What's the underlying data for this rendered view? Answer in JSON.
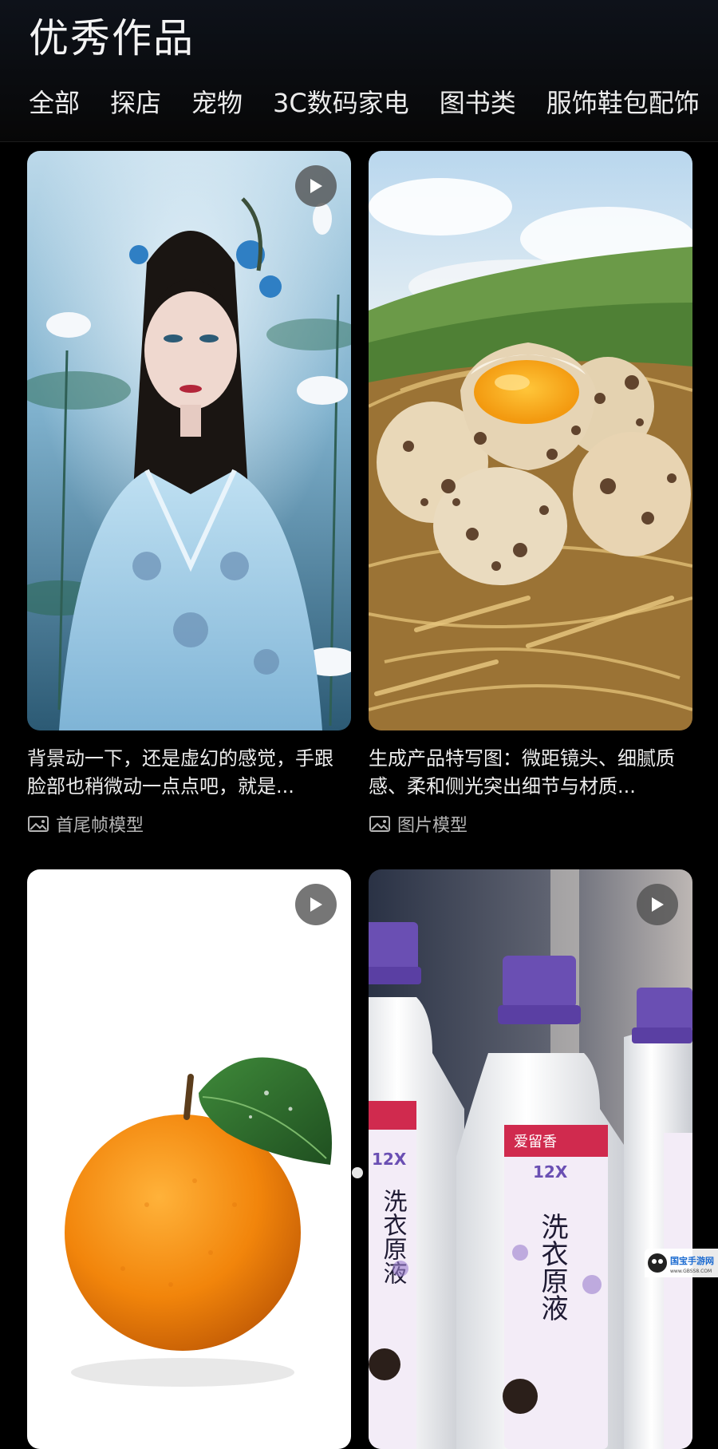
{
  "header": {
    "title": "优秀作品",
    "tabs": [
      "全部",
      "探店",
      "宠物",
      "3C数码家电",
      "图书类",
      "服饰鞋包配饰"
    ]
  },
  "cards": [
    {
      "description": "背景动一下，还是虚幻的感觉，手跟脸部也稍微动一点点吧，就是...",
      "model": "首尾帧模型",
      "has_play": true,
      "image": "woman-lotus-hanfu"
    },
    {
      "description": "生成产品特写图：微距镜头、细腻质感、柔和侧光突出细节与材质...",
      "model": "图片模型",
      "has_play": false,
      "image": "quail-eggs-nest"
    },
    {
      "has_play": true,
      "image": "orange-with-leaf"
    },
    {
      "has_play": true,
      "image": "laundry-detergent-bottles",
      "product_text": {
        "brand": "爱留香",
        "badge": "12X",
        "name": "洗衣原液"
      }
    }
  ],
  "icons": {
    "play": "play-icon",
    "model": "image-icon",
    "scroll": "page-dot"
  },
  "watermark": {
    "text": "国宝手游网",
    "url": "www.GBSS8.COM"
  },
  "colors": {
    "background": "#000000",
    "text": "#ededed",
    "meta": "#b5b5b5"
  }
}
